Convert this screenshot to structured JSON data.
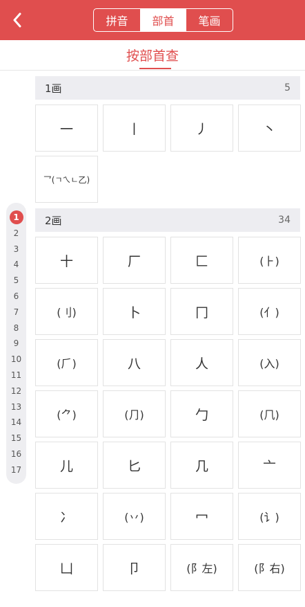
{
  "header": {
    "tabs": [
      {
        "label": "拼音",
        "active": false
      },
      {
        "label": "部首",
        "active": true
      },
      {
        "label": "笔画",
        "active": false
      }
    ],
    "accent_color": "#e04e4e"
  },
  "subtitle": "按部首查",
  "sections": [
    {
      "title": "1画",
      "count": "5",
      "items": [
        "一",
        "丨",
        "丿",
        "丶",
        "乛(ㄱㄟㄴ乙)"
      ]
    },
    {
      "title": "2画",
      "count": "34",
      "items": [
        "十",
        "厂",
        "匚",
        "(⺊)",
        "(刂)",
        "卜",
        "冂",
        "(亻)",
        "(⺁)",
        "八",
        "人",
        "(入)",
        "(⺈)",
        "(⺆)",
        "勹",
        "(⺇)",
        "儿",
        "匕",
        "几",
        "亠",
        "冫",
        "(丷)",
        "冖",
        "(讠)",
        "凵",
        "卩",
        "(阝左)",
        "(阝右)"
      ]
    }
  ],
  "index": {
    "items": [
      "1",
      "2",
      "3",
      "4",
      "5",
      "6",
      "7",
      "8",
      "9",
      "10",
      "11",
      "12",
      "13",
      "14",
      "15",
      "16",
      "17"
    ],
    "active": "1"
  }
}
